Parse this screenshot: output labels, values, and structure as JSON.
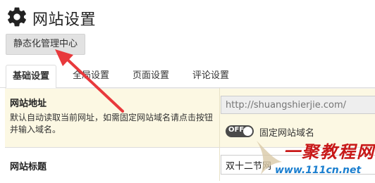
{
  "page": {
    "title": "网站设置",
    "icon": "gear-icon"
  },
  "toolbar": {
    "static_button_label": "静态化管理中心"
  },
  "tabs": [
    {
      "label": "基础设置",
      "active": true
    },
    {
      "label": "全局设置",
      "active": false
    },
    {
      "label": "页面设置",
      "active": false
    },
    {
      "label": "评论设置",
      "active": false
    }
  ],
  "form": {
    "site_url": {
      "label": "网站地址",
      "description": "默认自动读取当前网址，如需固定网站域名请点击按钮并输入域名。",
      "placeholder": "http://shuangshierjie.com/",
      "value": ""
    },
    "fix_domain_toggle": {
      "state_label": "OFF",
      "label": "固定网站域名"
    },
    "site_title": {
      "label": "网站标题",
      "value": "双十二节网"
    }
  },
  "watermark": {
    "text": "一聚教程网",
    "url_text": "www.111cn.net"
  },
  "colors": {
    "row_highlight": "#fcf8e3",
    "toggle_bg": "#4a4a4a",
    "annotation_arrow": "#e8393c",
    "watermark_red": "#c81818",
    "watermark_blue": "#1a7ecf"
  }
}
